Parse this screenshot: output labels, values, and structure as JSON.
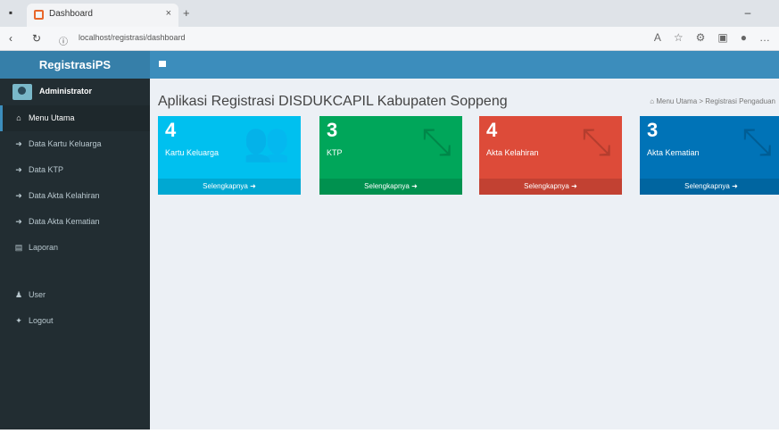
{
  "browser": {
    "tab_title": "Dashboard",
    "tab_close": "×",
    "new_tab": "+",
    "url": "localhost/registrasi/dashboard",
    "minimize": "–"
  },
  "app": {
    "brand": "RegistrasiPS",
    "user": "Administrator",
    "title": "Aplikasi Registrasi DISDUKCAPIL Kabupaten Soppeng",
    "breadcrumb": "Menu Utama > Registrasi Pengaduan"
  },
  "sidebar": {
    "items": [
      {
        "label": "Menu Utama",
        "icon": "home-icon"
      },
      {
        "label": "Data Kartu Keluarga",
        "icon": "arrow-icon"
      },
      {
        "label": "Data KTP",
        "icon": "arrow-icon"
      },
      {
        "label": "Data Akta Kelahiran",
        "icon": "arrow-icon"
      },
      {
        "label": "Data Akta Kematian",
        "icon": "arrow-icon"
      },
      {
        "label": "Laporan",
        "icon": "report-icon"
      },
      {
        "label": "User",
        "icon": "user-icon"
      },
      {
        "label": "Logout",
        "icon": "logout-icon"
      }
    ]
  },
  "boxes": [
    {
      "number": "4",
      "label": "Kartu Keluarga",
      "link": "Selengkapnya",
      "color": "#00c0ef",
      "icon": "users-icon"
    },
    {
      "number": "3",
      "label": "KTP",
      "link": "Selengkapnya",
      "color": "#00a65a",
      "icon": "compress-icon"
    },
    {
      "number": "4",
      "label": "Akta Kelahiran",
      "link": "Selengkapnya",
      "color": "#dd4b39",
      "icon": "compress-icon"
    },
    {
      "number": "3",
      "label": "Akta Kematian",
      "link": "Selengkapnya",
      "color": "#0073b7",
      "icon": "compress-icon"
    }
  ]
}
